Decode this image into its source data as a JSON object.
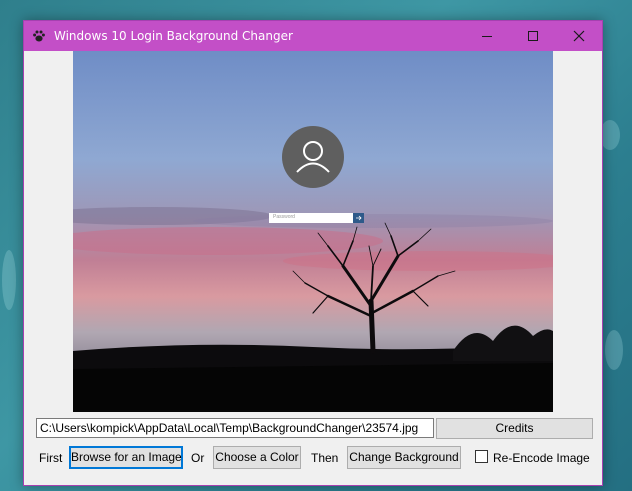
{
  "window": {
    "title": "Windows 10 Login Background Changer",
    "titlebar_color": "#c34fc7"
  },
  "icons": {
    "app": "paw-icon",
    "minimize": "minimize-icon",
    "maximize": "maximize-icon",
    "close": "close-icon",
    "avatar": "user-avatar-icon",
    "submit": "arrow-right-icon"
  },
  "preview": {
    "password_placeholder": "Password"
  },
  "controls": {
    "image_path": "C:\\Users\\kompick\\AppData\\Local\\Temp\\BackgroundChanger\\23574.jpg",
    "credits_label": "Credits",
    "first_label": "First",
    "browse_label": "Browse for an Image",
    "or_label": "Or",
    "color_label": "Choose a Color",
    "then_label": "Then",
    "change_label": "Change Background",
    "reencode_label": "Re-Encode Image",
    "reencode_checked": false
  }
}
